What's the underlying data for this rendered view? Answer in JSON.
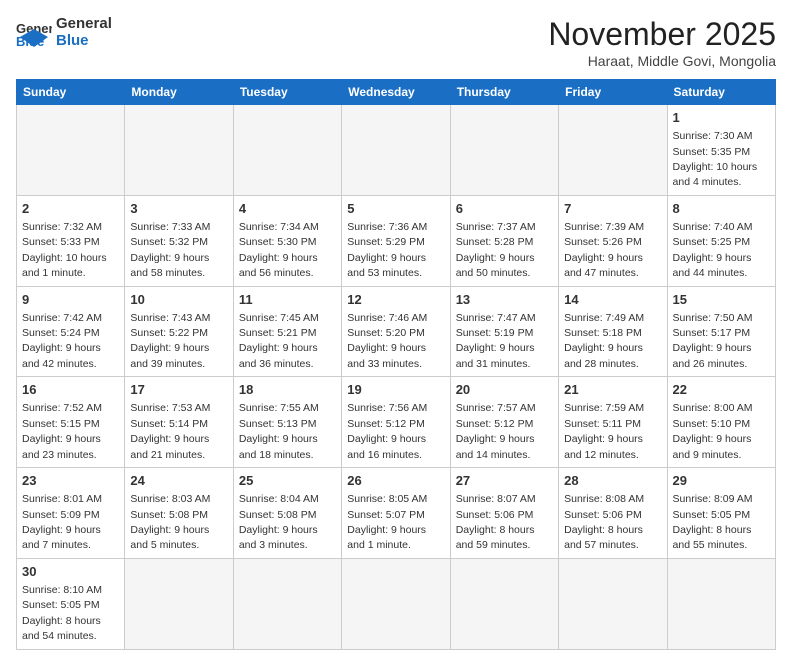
{
  "header": {
    "logo_general": "General",
    "logo_blue": "Blue",
    "month_title": "November 2025",
    "location": "Haraat, Middle Govi, Mongolia"
  },
  "weekdays": [
    "Sunday",
    "Monday",
    "Tuesday",
    "Wednesday",
    "Thursday",
    "Friday",
    "Saturday"
  ],
  "weeks": [
    [
      {
        "day": "",
        "info": ""
      },
      {
        "day": "",
        "info": ""
      },
      {
        "day": "",
        "info": ""
      },
      {
        "day": "",
        "info": ""
      },
      {
        "day": "",
        "info": ""
      },
      {
        "day": "",
        "info": ""
      },
      {
        "day": "1",
        "info": "Sunrise: 7:30 AM\nSunset: 5:35 PM\nDaylight: 10 hours\nand 4 minutes."
      }
    ],
    [
      {
        "day": "2",
        "info": "Sunrise: 7:32 AM\nSunset: 5:33 PM\nDaylight: 10 hours\nand 1 minute."
      },
      {
        "day": "3",
        "info": "Sunrise: 7:33 AM\nSunset: 5:32 PM\nDaylight: 9 hours\nand 58 minutes."
      },
      {
        "day": "4",
        "info": "Sunrise: 7:34 AM\nSunset: 5:30 PM\nDaylight: 9 hours\nand 56 minutes."
      },
      {
        "day": "5",
        "info": "Sunrise: 7:36 AM\nSunset: 5:29 PM\nDaylight: 9 hours\nand 53 minutes."
      },
      {
        "day": "6",
        "info": "Sunrise: 7:37 AM\nSunset: 5:28 PM\nDaylight: 9 hours\nand 50 minutes."
      },
      {
        "day": "7",
        "info": "Sunrise: 7:39 AM\nSunset: 5:26 PM\nDaylight: 9 hours\nand 47 minutes."
      },
      {
        "day": "8",
        "info": "Sunrise: 7:40 AM\nSunset: 5:25 PM\nDaylight: 9 hours\nand 44 minutes."
      }
    ],
    [
      {
        "day": "9",
        "info": "Sunrise: 7:42 AM\nSunset: 5:24 PM\nDaylight: 9 hours\nand 42 minutes."
      },
      {
        "day": "10",
        "info": "Sunrise: 7:43 AM\nSunset: 5:22 PM\nDaylight: 9 hours\nand 39 minutes."
      },
      {
        "day": "11",
        "info": "Sunrise: 7:45 AM\nSunset: 5:21 PM\nDaylight: 9 hours\nand 36 minutes."
      },
      {
        "day": "12",
        "info": "Sunrise: 7:46 AM\nSunset: 5:20 PM\nDaylight: 9 hours\nand 33 minutes."
      },
      {
        "day": "13",
        "info": "Sunrise: 7:47 AM\nSunset: 5:19 PM\nDaylight: 9 hours\nand 31 minutes."
      },
      {
        "day": "14",
        "info": "Sunrise: 7:49 AM\nSunset: 5:18 PM\nDaylight: 9 hours\nand 28 minutes."
      },
      {
        "day": "15",
        "info": "Sunrise: 7:50 AM\nSunset: 5:17 PM\nDaylight: 9 hours\nand 26 minutes."
      }
    ],
    [
      {
        "day": "16",
        "info": "Sunrise: 7:52 AM\nSunset: 5:15 PM\nDaylight: 9 hours\nand 23 minutes."
      },
      {
        "day": "17",
        "info": "Sunrise: 7:53 AM\nSunset: 5:14 PM\nDaylight: 9 hours\nand 21 minutes."
      },
      {
        "day": "18",
        "info": "Sunrise: 7:55 AM\nSunset: 5:13 PM\nDaylight: 9 hours\nand 18 minutes."
      },
      {
        "day": "19",
        "info": "Sunrise: 7:56 AM\nSunset: 5:12 PM\nDaylight: 9 hours\nand 16 minutes."
      },
      {
        "day": "20",
        "info": "Sunrise: 7:57 AM\nSunset: 5:12 PM\nDaylight: 9 hours\nand 14 minutes."
      },
      {
        "day": "21",
        "info": "Sunrise: 7:59 AM\nSunset: 5:11 PM\nDaylight: 9 hours\nand 12 minutes."
      },
      {
        "day": "22",
        "info": "Sunrise: 8:00 AM\nSunset: 5:10 PM\nDaylight: 9 hours\nand 9 minutes."
      }
    ],
    [
      {
        "day": "23",
        "info": "Sunrise: 8:01 AM\nSunset: 5:09 PM\nDaylight: 9 hours\nand 7 minutes."
      },
      {
        "day": "24",
        "info": "Sunrise: 8:03 AM\nSunset: 5:08 PM\nDaylight: 9 hours\nand 5 minutes."
      },
      {
        "day": "25",
        "info": "Sunrise: 8:04 AM\nSunset: 5:08 PM\nDaylight: 9 hours\nand 3 minutes."
      },
      {
        "day": "26",
        "info": "Sunrise: 8:05 AM\nSunset: 5:07 PM\nDaylight: 9 hours\nand 1 minute."
      },
      {
        "day": "27",
        "info": "Sunrise: 8:07 AM\nSunset: 5:06 PM\nDaylight: 8 hours\nand 59 minutes."
      },
      {
        "day": "28",
        "info": "Sunrise: 8:08 AM\nSunset: 5:06 PM\nDaylight: 8 hours\nand 57 minutes."
      },
      {
        "day": "29",
        "info": "Sunrise: 8:09 AM\nSunset: 5:05 PM\nDaylight: 8 hours\nand 55 minutes."
      }
    ],
    [
      {
        "day": "30",
        "info": "Sunrise: 8:10 AM\nSunset: 5:05 PM\nDaylight: 8 hours\nand 54 minutes."
      },
      {
        "day": "",
        "info": ""
      },
      {
        "day": "",
        "info": ""
      },
      {
        "day": "",
        "info": ""
      },
      {
        "day": "",
        "info": ""
      },
      {
        "day": "",
        "info": ""
      },
      {
        "day": "",
        "info": ""
      }
    ]
  ]
}
